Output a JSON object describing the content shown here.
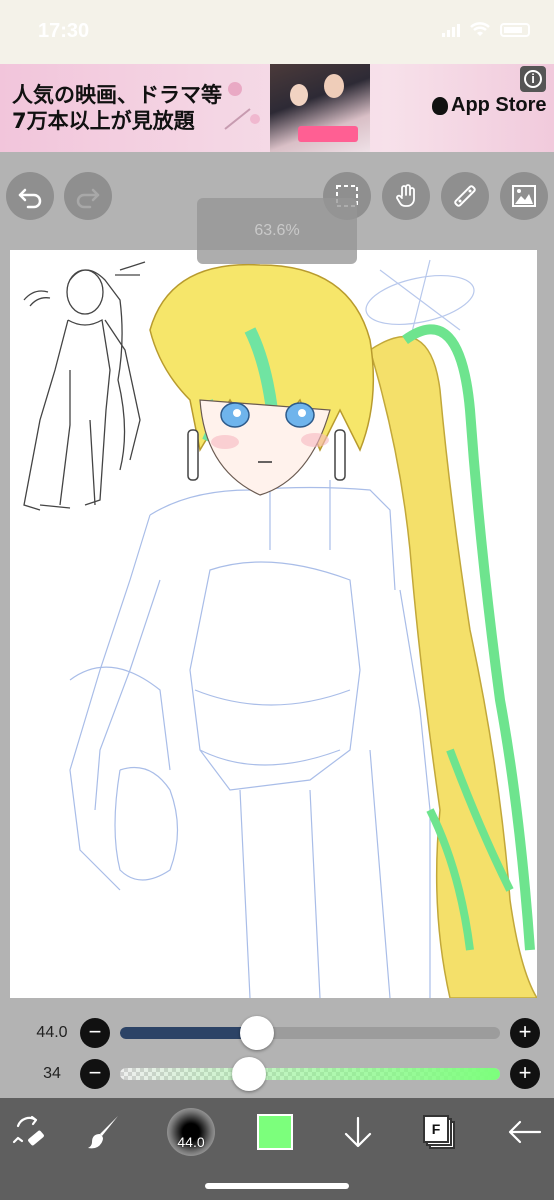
{
  "status_bar": {
    "time": "17:30"
  },
  "ad": {
    "line1": "人気の映画、ドラマ等",
    "line2": "7万本以上が見放題",
    "store_label": "App Store",
    "info_label": "i"
  },
  "zoom": {
    "label": "63.6%"
  },
  "sliders": {
    "brush_size": {
      "value": "44.0",
      "level_fraction": 0.36
    },
    "opacity": {
      "value": "34",
      "level_fraction": 0.34
    }
  },
  "bottom_bar": {
    "brush_size_label": "44.0",
    "layers_label": "F",
    "current_color": "#7cff7c"
  },
  "colors": {
    "toolbar_bg": "#b3b3b3",
    "button_bg": "#8f8f8f",
    "bottom_bar_bg": "#5f5f5f",
    "slider_fill": "#2c4366"
  },
  "icons": [
    "undo-icon",
    "redo-icon",
    "selection-icon",
    "hand-tool-icon",
    "ruler-icon",
    "image-icon",
    "transform-icon",
    "brush-icon",
    "move-down-icon",
    "back-arrow-icon"
  ]
}
